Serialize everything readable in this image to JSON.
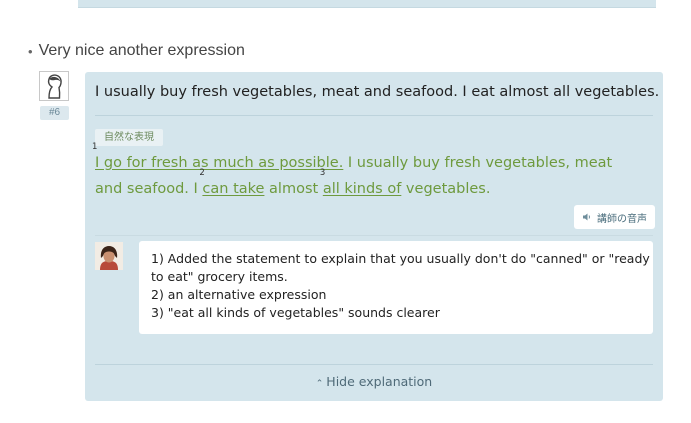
{
  "section": {
    "title": "Very nice another expression"
  },
  "post": {
    "number_badge": "#6",
    "original_sentence": "I usually buy fresh vegetables, meat and seafood. I eat almost all vegetables.",
    "tag_label": "自然な表現",
    "correction": {
      "markers": [
        "1",
        "2",
        "3"
      ],
      "segments": [
        "I go for fresh as much as possible.",
        " I usually buy fresh vegetables, meat and seafood. I ",
        "can take",
        " almost ",
        "all kinds of",
        " vegetables."
      ]
    },
    "audio_button_label": "講師の音声",
    "explanations": [
      "1) Added the statement to explain that you usually don't do \"canned\" or \"ready",
      "to eat\" grocery items.",
      "2) an alternative expression",
      "3) \"eat all kinds of vegetables\" sounds clearer"
    ],
    "hide_explanation_label": "Hide explanation"
  },
  "colors": {
    "card_background": "#d4e5ec",
    "correction_text": "#6e9a3e",
    "link_text": "#4f6a78"
  },
  "icons": [
    "user-silhouette-icon",
    "speaker-icon",
    "chevron-up-icon",
    "teacher-photo"
  ]
}
